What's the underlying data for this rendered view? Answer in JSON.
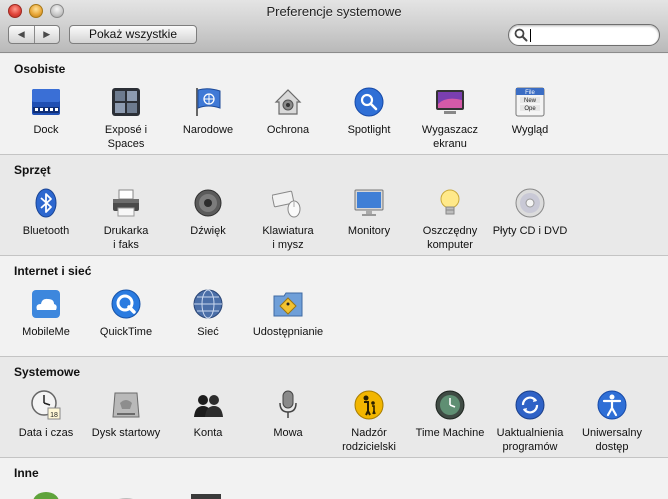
{
  "window": {
    "title": "Preferencje systemowe"
  },
  "toolbar": {
    "back_glyph": "◀",
    "forward_glyph": "▶",
    "show_all_label": "Pokaż wszystkie",
    "search_value": "",
    "search_placeholder": ""
  },
  "sections": [
    {
      "title": "Osobiste",
      "panes": [
        {
          "name": "dock",
          "label": "Dock",
          "icon": "dock-icon"
        },
        {
          "name": "expose-spaces",
          "label": "Exposé i\nSpaces",
          "icon": "expose-spaces-icon"
        },
        {
          "name": "international",
          "label": "Narodowe",
          "icon": "flag-icon"
        },
        {
          "name": "security",
          "label": "Ochrona",
          "icon": "house-lock-icon"
        },
        {
          "name": "spotlight",
          "label": "Spotlight",
          "icon": "spotlight-icon"
        },
        {
          "name": "screensaver",
          "label": "Wygaszacz\nekranu",
          "icon": "screensaver-icon"
        },
        {
          "name": "appearance",
          "label": "Wygląd",
          "icon": "appearance-icon"
        }
      ]
    },
    {
      "title": "Sprzęt",
      "panes": [
        {
          "name": "bluetooth",
          "label": "Bluetooth",
          "icon": "bluetooth-icon"
        },
        {
          "name": "printers",
          "label": "Drukarka\ni faks",
          "icon": "printer-icon"
        },
        {
          "name": "sound",
          "label": "Dźwięk",
          "icon": "speaker-icon"
        },
        {
          "name": "keyboard-mouse",
          "label": "Klawiatura\ni mysz",
          "icon": "keyboard-mouse-icon"
        },
        {
          "name": "displays",
          "label": "Monitory",
          "icon": "monitor-icon"
        },
        {
          "name": "energy",
          "label": "Oszczędny\nkomputer",
          "icon": "lightbulb-icon"
        },
        {
          "name": "cd-dvd",
          "label": "Płyty CD i DVD",
          "icon": "disc-icon"
        }
      ]
    },
    {
      "title": "Internet i sieć",
      "panes": [
        {
          "name": "mobileme",
          "label": "MobileMe",
          "icon": "cloud-icon"
        },
        {
          "name": "quicktime",
          "label": "QuickTime",
          "icon": "quicktime-icon"
        },
        {
          "name": "network",
          "label": "Sieć",
          "icon": "globe-icon"
        },
        {
          "name": "sharing",
          "label": "Udostępnianie",
          "icon": "sharing-folder-icon"
        }
      ]
    },
    {
      "title": "Systemowe",
      "panes": [
        {
          "name": "date-time",
          "label": "Data i czas",
          "icon": "clock-calendar-icon",
          "badge": "18"
        },
        {
          "name": "startup-disk",
          "label": "Dysk startowy",
          "icon": "hard-disk-icon"
        },
        {
          "name": "accounts",
          "label": "Konta",
          "icon": "users-icon"
        },
        {
          "name": "speech",
          "label": "Mowa",
          "icon": "microphone-icon"
        },
        {
          "name": "parental-controls",
          "label": "Nadzór\nrodzicielski",
          "icon": "parental-icon"
        },
        {
          "name": "time-machine",
          "label": "Time Machine",
          "icon": "time-machine-icon"
        },
        {
          "name": "software-update",
          "label": "Uaktualnienia\nprogramów",
          "icon": "software-update-icon"
        },
        {
          "name": "universal-access",
          "label": "Uniwersalny\ndostęp",
          "icon": "universal-access-icon"
        }
      ]
    },
    {
      "title": "Inne",
      "panes": []
    }
  ],
  "appearance_icon": {
    "line1": "File",
    "line2": "New",
    "line3": "Ope"
  },
  "colors": {
    "accent_blue": "#2f6fd6",
    "dock_blue": "#1f4fb3",
    "parental_yellow": "#f2b600"
  }
}
